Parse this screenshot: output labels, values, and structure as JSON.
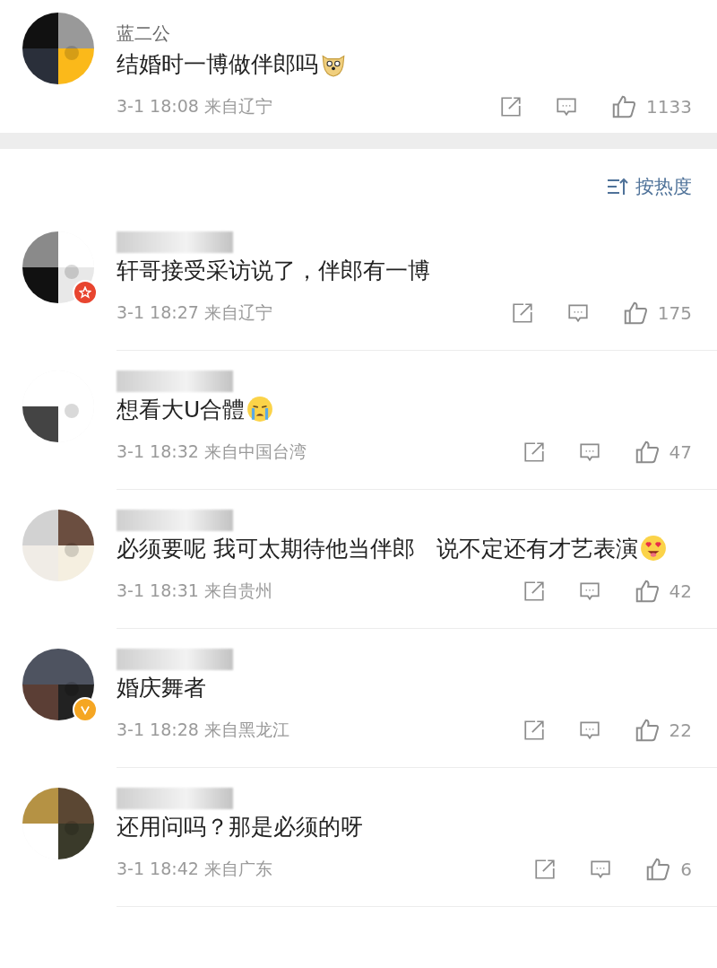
{
  "pinned_comment": {
    "author": "蓝二公",
    "emoji": {
      "kind": "doge"
    },
    "text": "结婚时一博做伴郎吗",
    "time": "3-1 18:08",
    "location": "来自辽宁",
    "likes": "1133"
  },
  "sort": {
    "label": "按热度"
  },
  "comments": [
    {
      "author_hidden": true,
      "badge": {
        "kind": "star"
      },
      "text": "轩哥接受采访说了，伴郎有一博",
      "time": "3-1 18:27",
      "location": "来自辽宁",
      "likes": "175"
    },
    {
      "author_hidden": true,
      "emoji": {
        "kind": "crying"
      },
      "text": "想看大U合體",
      "time": "3-1 18:32",
      "location": "来自中国台湾",
      "likes": "47"
    },
    {
      "author_hidden": true,
      "emoji": {
        "kind": "heart-eyes"
      },
      "text": "必须要呢 我可太期待他当伴郎   说不定还有才艺表演",
      "time": "3-1 18:31",
      "location": "来自贵州",
      "likes": "42"
    },
    {
      "author_hidden": true,
      "badge": {
        "kind": "verified"
      },
      "text": "婚庆舞者",
      "time": "3-1 18:28",
      "location": "来自黑龙江",
      "likes": "22"
    },
    {
      "author_hidden": true,
      "text": "还用问吗？那是必须的呀",
      "time": "3-1 18:42",
      "location": "来自广东",
      "likes": "6"
    }
  ]
}
